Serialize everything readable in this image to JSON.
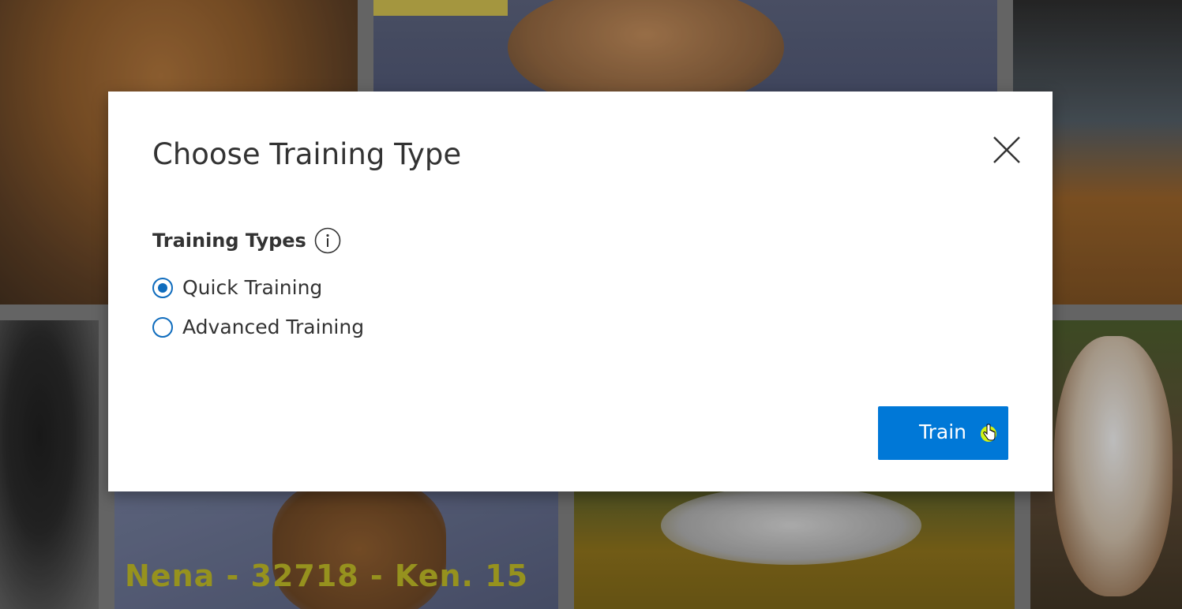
{
  "background": {
    "caption": "Nena - 32718 - Ken. 15"
  },
  "dialog": {
    "title": "Choose Training Type",
    "close_icon": "close-icon",
    "section_label": "Training Types",
    "info_icon": "info-icon",
    "options": [
      {
        "label": "Quick Training",
        "selected": true
      },
      {
        "label": "Advanced Training",
        "selected": false
      }
    ],
    "train_button_label": "Train"
  },
  "colors": {
    "accent": "#0078d7",
    "radio": "#0f6cbd",
    "text": "#333333"
  }
}
